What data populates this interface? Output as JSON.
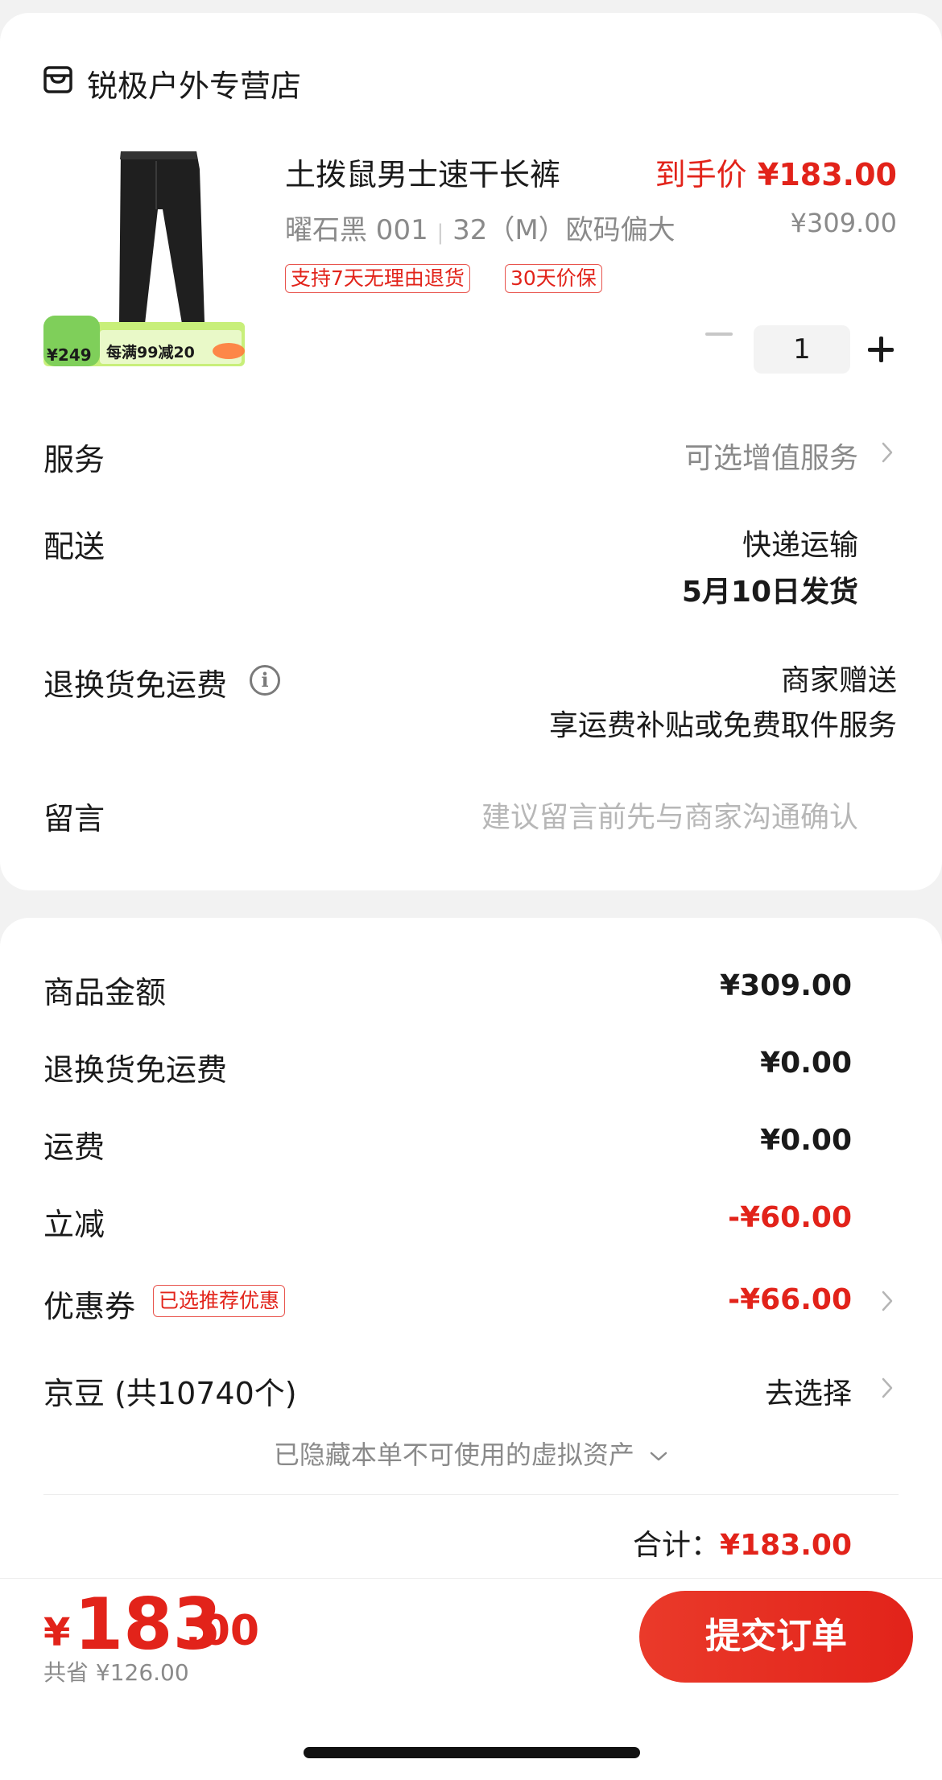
{
  "store": {
    "name": "锐极户外专营店"
  },
  "product": {
    "title": "土拨鼠男士速干长裤",
    "price_label": "到手价",
    "price": "¥183.00",
    "spec": "曜石黑 001 ",
    "size": " 32（M）欧码偏大",
    "original_price": "¥309.00",
    "tags": [
      "支持7天无理由退货",
      "30天价保"
    ],
    "quantity": "1",
    "promo_banner": {
      "price": "¥249",
      "text": "每满99减20"
    }
  },
  "service": {
    "label": "服务",
    "value": "可选增值服务"
  },
  "delivery": {
    "label": "配送",
    "method": "快递运输",
    "date": "5月10日发货"
  },
  "return_shipping": {
    "label": "退换货免运费",
    "value1": "商家赠送",
    "value2": "享运费补贴或免费取件服务"
  },
  "message": {
    "label": "留言",
    "placeholder": "建议留言前先与商家沟通确认"
  },
  "summary": {
    "goods_amount": {
      "label": "商品金额",
      "value": "¥309.00"
    },
    "return_fee": {
      "label": "退换货免运费",
      "value": "¥0.00"
    },
    "shipping": {
      "label": "运费",
      "value": "¥0.00"
    },
    "discount": {
      "label": "立减",
      "value": "-¥60.00"
    },
    "coupon": {
      "label": "优惠券",
      "badge": "已选推荐优惠",
      "value": "-¥66.00"
    },
    "jingdou": {
      "label": "京豆 (共10740个)",
      "value": "去选择"
    },
    "hidden_assets": "已隐藏本单不可使用的虚拟资产",
    "total_label": "合计：",
    "total_value": "¥183.00"
  },
  "bottom_bar": {
    "yen": "¥",
    "integer": "183",
    "decimal": ".00",
    "saved": "共省 ¥126.00",
    "submit_label": "提交订单"
  },
  "colors": {
    "accent": "#e2231a",
    "gray_text": "#8a8a8a",
    "background": "#f2f2f2"
  }
}
